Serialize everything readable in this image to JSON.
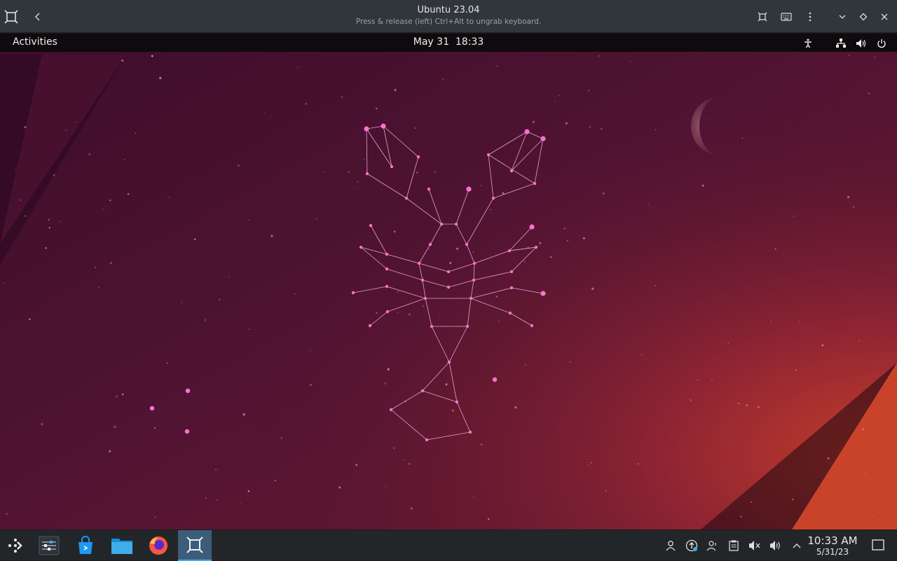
{
  "window": {
    "title": "Ubuntu 23.04",
    "subtitle": "Press & release (left) Ctrl+Alt to ungrab keyboard.",
    "icons": [
      "app-icon",
      "back-icon",
      "fullscreen-icon",
      "keyboard-icon",
      "menu-icon",
      "minimize-icon",
      "maximize-icon",
      "close-icon"
    ]
  },
  "guest_topbar": {
    "activities": "Activities",
    "clock": "May 31  18:33",
    "icons": [
      "accessibility-icon",
      "network-icon",
      "volume-icon",
      "power-icon"
    ]
  },
  "taskbar": {
    "apps": [
      "app-launcher-icon",
      "system-settings-icon",
      "discover-store-icon",
      "file-manager-icon",
      "firefox-icon",
      "virt-viewer-icon"
    ],
    "tray": [
      "user-icon",
      "update-icon",
      "network-user-icon",
      "clipboard-icon",
      "mute-icon",
      "volume-icon",
      "tray-expand-icon"
    ],
    "time": "10:33 AM",
    "date": "5/31/23"
  },
  "colors": {
    "titlebar": "#31363b",
    "taskbar": "#232629",
    "accent": "#3daee9",
    "wallpaper_dark": "#3a0f28",
    "wallpaper_warm": "#b2322a",
    "constellation": "#ff6fd0"
  }
}
